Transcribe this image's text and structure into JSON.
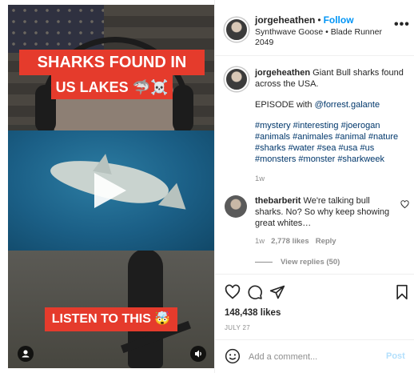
{
  "media": {
    "caption_line1": "SHARKS FOUND IN",
    "caption_line2": "US LAKES 🦈☠️",
    "caption_line3": "LISTEN TO THIS 🤯",
    "user_tag_icon": "person-icon",
    "audio_icon": "speaker-icon",
    "play_icon": "play-icon"
  },
  "header": {
    "username": "jorgeheathen",
    "separator": "•",
    "follow_label": "Follow",
    "audio_text": "Synthwave Goose • Blade Runner 2049",
    "more_label": "•••"
  },
  "caption": {
    "username": "jorgeheathen",
    "text": "Giant Bull sharks found across the USA.",
    "episode_prefix": "EPISODE with",
    "mention": "@forrest.galante",
    "hashtags": "#mystery #interesting #joerogan #animals #animales #animal #nature #sharks #water #sea #usa #us #monsters #monster #sharkweek",
    "time": "1w"
  },
  "comment": {
    "username": "thebarberit",
    "text": "We're talking bull sharks. No? So why keep showing great whites…",
    "time": "1w",
    "likes": "2,778 likes",
    "reply_label": "Reply",
    "view_replies": "View replies (50)"
  },
  "actions": {
    "likes": "148,438 likes",
    "date": "JULY 27"
  },
  "add_comment": {
    "placeholder": "Add a comment...",
    "post_label": "Post"
  },
  "colors": {
    "accent": "#0095f6",
    "caption_red": "#e53b2c",
    "post_disabled": "#b2dffc"
  }
}
